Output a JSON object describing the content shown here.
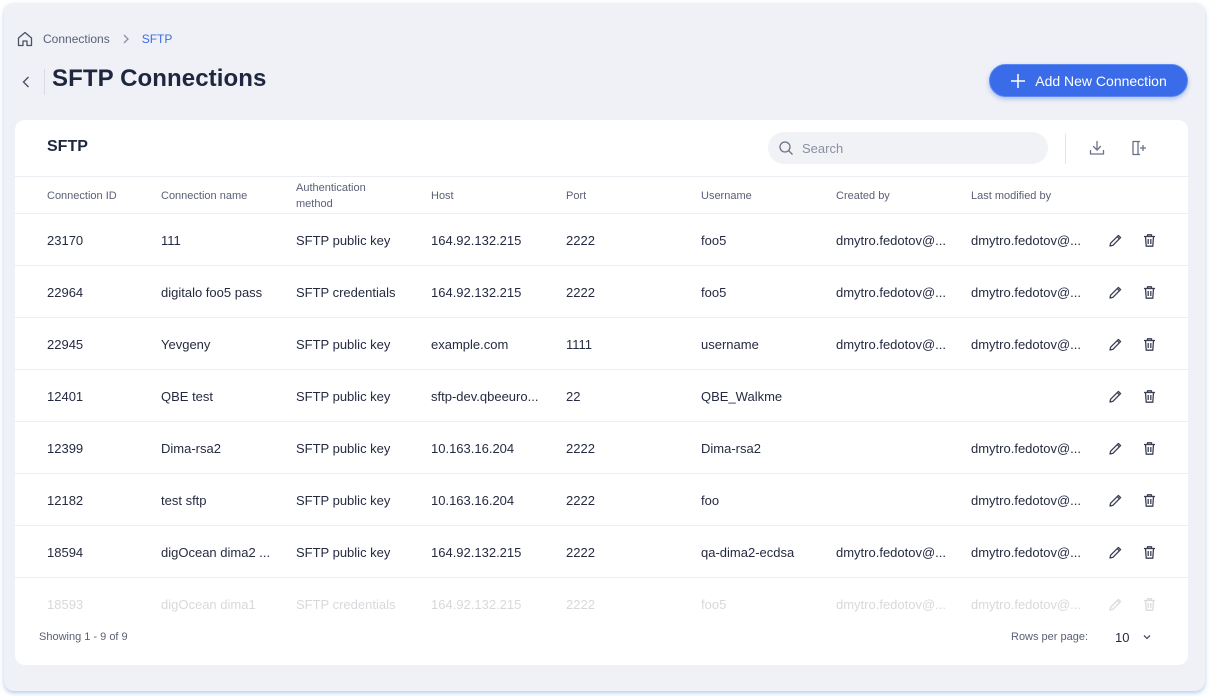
{
  "breadcrumb": {
    "items": [
      "Connections"
    ],
    "current": "SFTP"
  },
  "header": {
    "title": "SFTP Connections",
    "add_button_label": "Add New Connection"
  },
  "card": {
    "title": "SFTP"
  },
  "search": {
    "placeholder": "Search",
    "value": ""
  },
  "toolbar": {
    "download_icon": "download-icon",
    "columns_icon": "add-column-icon"
  },
  "table": {
    "columns": [
      "Connection ID",
      "Connection name",
      "Authentication method",
      "Host",
      "Port",
      "Username",
      "Created by",
      "Last modified by"
    ],
    "rows": [
      [
        "23170",
        "111",
        "SFTP public key",
        "164.92.132.215",
        "2222",
        "foo5",
        "dmytro.fedotov@...",
        "dmytro.fedotov@..."
      ],
      [
        "22964",
        "digitalo foo5 pass",
        "SFTP credentials",
        "164.92.132.215",
        "2222",
        "foo5",
        "dmytro.fedotov@...",
        "dmytro.fedotov@..."
      ],
      [
        "22945",
        "Yevgeny",
        "SFTP public key",
        "example.com",
        "1111",
        "username",
        "dmytro.fedotov@...",
        "dmytro.fedotov@..."
      ],
      [
        "12401",
        "QBE test",
        "SFTP public key",
        "sftp-dev.qbeeuro...",
        "22",
        "QBE_Walkme",
        "",
        ""
      ],
      [
        "12399",
        "Dima-rsa2",
        "SFTP public key",
        "10.163.16.204",
        "2222",
        "Dima-rsa2",
        "",
        "dmytro.fedotov@..."
      ],
      [
        "12182",
        "test sftp",
        "SFTP public key",
        "10.163.16.204",
        "2222",
        "foo",
        "",
        "dmytro.fedotov@..."
      ],
      [
        "18594",
        "digOcean dima2 ...",
        "SFTP public key",
        "164.92.132.215",
        "2222",
        "qa-dima2-ecdsa",
        "dmytro.fedotov@...",
        "dmytro.fedotov@..."
      ],
      [
        "18593",
        "digOcean dima1",
        "SFTP credentials",
        "164.92.132.215",
        "2222",
        "foo5",
        "dmytro.fedotov@...",
        "dmytro.fedotov@..."
      ]
    ]
  },
  "footer": {
    "showing": "Showing 1 - 9 of 9",
    "rows_per_page_label": "Rows per page:",
    "rows_per_page_value": "10"
  },
  "colors": {
    "accent": "#3a6be8",
    "background": "#eff1f7",
    "text": "#252b41"
  }
}
